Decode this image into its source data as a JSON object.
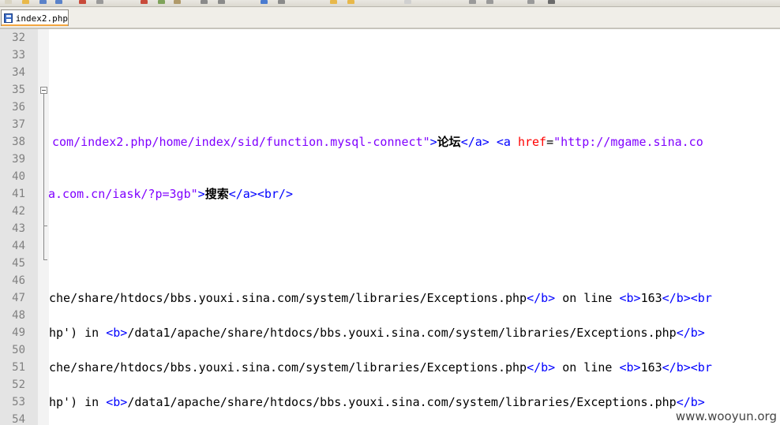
{
  "tab": {
    "filename": "index2.php",
    "icon": "save-icon"
  },
  "colors": {
    "tag": "#0000ff",
    "attribute": "#ff0000",
    "string": "#8000ff",
    "text": "#000000",
    "line_number": "#808080"
  },
  "line_numbers": [
    "32",
    "33",
    "34",
    "35",
    "36",
    "37",
    "38",
    "39",
    "40",
    "41",
    "42",
    "43",
    "44",
    "45",
    "46",
    "47",
    "48",
    "49",
    "50",
    "51",
    "52",
    "53",
    "54"
  ],
  "code_lines": {
    "l38": {
      "s1": "com/index2.php/home/index/sid/function.mysql-connect\"",
      "gt": ">",
      "cjk": "论坛",
      "close": "</a>",
      "sp": " ",
      "open": "<a ",
      "attr": "href",
      "eq": "=",
      "s2": "\"http://mgame.sina.co"
    },
    "l41": {
      "s1": "a.com.cn/iask/?p=3gb\"",
      "gt": ">",
      "cjk": "搜索",
      "close": "</a><br/>"
    },
    "l47": {
      "t1": "che/share/htdocs/bbs.youxi.sina.com/system/libraries/Exceptions.php",
      "tag1": "</b>",
      "t2": " on line ",
      "tag2": "<b>",
      "t3": "163",
      "tag3": "</b><br"
    },
    "l49": {
      "t1": "hp') in ",
      "tag1": "<b>",
      "t2": "/data1/apache/share/htdocs/bbs.youxi.sina.com/system/libraries/Exceptions.php",
      "tag2": "</b>"
    },
    "l51": {
      "t1": "che/share/htdocs/bbs.youxi.sina.com/system/libraries/Exceptions.php",
      "tag1": "</b>",
      "t2": " on line ",
      "tag2": "<b>",
      "t3": "163",
      "tag3": "</b><br"
    },
    "l53": {
      "t1": "hp') in ",
      "tag1": "<b>",
      "t2": "/data1/apache/share/htdocs/bbs.youxi.sina.com/system/libraries/Exceptions.php",
      "tag2": "</b>"
    }
  },
  "watermark": "www.wooyun.org"
}
